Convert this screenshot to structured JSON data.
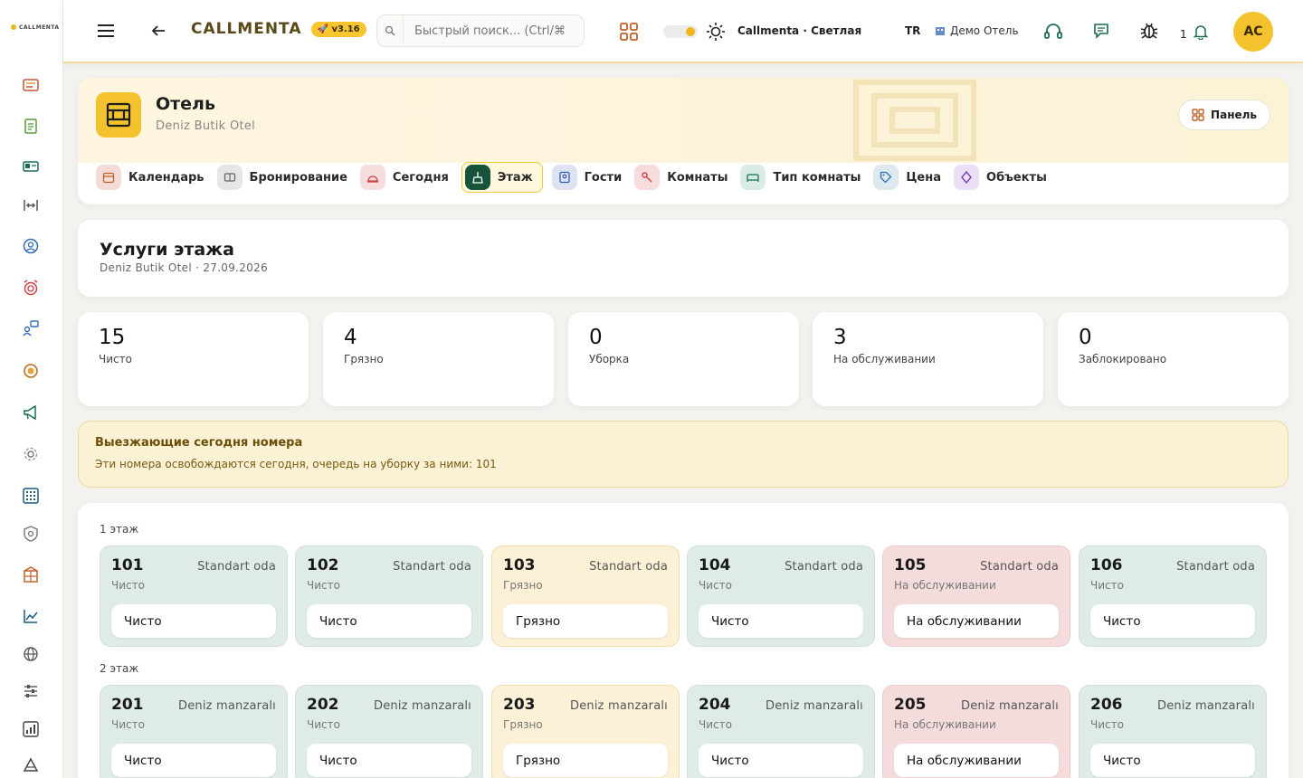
{
  "app": {
    "brand": "CALLMENTA",
    "version": "v3.16",
    "logo_text": "CALLMENTA"
  },
  "topbar": {
    "search_placeholder": "Быстрый поиск... (Ctrl/⌘",
    "theme_label": "Callmenta · Светлая",
    "language": "TR",
    "hotel_selector": "Демо Отель",
    "notifications_count": "1",
    "avatar_initials": "AC"
  },
  "sidebar": {
    "icons": [
      "reception-icon",
      "clipboard-icon",
      "id-card-icon",
      "transfer-icon",
      "support-agent-icon",
      "alarm-icon",
      "chat-user-icon",
      "medal-icon",
      "megaphone-icon",
      "settings-gear-icon",
      "grid-keypad-icon",
      "shield-icon",
      "building-icon",
      "chart-line-icon",
      "globe-icon",
      "sliders-icon",
      "report-chart-icon",
      "triangle-icon"
    ]
  },
  "header": {
    "title": "Отель",
    "subtitle": "Deniz Butik Otel",
    "panel_button": "Панель"
  },
  "tabs": [
    {
      "label": "Календарь",
      "icon": "calendar-icon",
      "color": "#f4dcd6",
      "active": false
    },
    {
      "label": "Бронирование",
      "icon": "booking-icon",
      "color": "#e6e6e6",
      "active": false
    },
    {
      "label": "Сегодня",
      "icon": "bell-service-icon",
      "color": "#f6dcdc",
      "active": false
    },
    {
      "label": "Этаж",
      "icon": "floor-broom-icon",
      "color": "#17523b",
      "active": true
    },
    {
      "label": "Гости",
      "icon": "guests-icon",
      "color": "#dde3f5",
      "active": false
    },
    {
      "label": "Комнаты",
      "icon": "key-icon",
      "color": "#f6dcdc",
      "active": false
    },
    {
      "label": "Тип комнаты",
      "icon": "bed-icon",
      "color": "#d8ece4",
      "active": false
    },
    {
      "label": "Цена",
      "icon": "tag-icon",
      "color": "#dde9ee",
      "active": false
    },
    {
      "label": "Объекты",
      "icon": "diamond-icon",
      "color": "#ebe0f5",
      "active": false
    }
  ],
  "page": {
    "title": "Услуги этажа",
    "subtitle": "Deniz Butik Otel · 27.09.2026"
  },
  "stats": [
    {
      "value": "15",
      "label": "Чисто"
    },
    {
      "value": "4",
      "label": "Грязно"
    },
    {
      "value": "0",
      "label": "Уборка"
    },
    {
      "value": "3",
      "label": "На обслуживании"
    },
    {
      "value": "0",
      "label": "Заблокировано"
    }
  ],
  "alert": {
    "title": "Выезжающие сегодня номера",
    "body": "Эти номера освобождаются сегодня, очередь на уборку за ними: 101"
  },
  "floors": [
    {
      "label": "1 этаж",
      "rooms": [
        {
          "number": "101",
          "type": "Standart oda",
          "status": "Чисто",
          "select": "Чисто",
          "state": "clean"
        },
        {
          "number": "102",
          "type": "Standart oda",
          "status": "Чисто",
          "select": "Чисто",
          "state": "clean"
        },
        {
          "number": "103",
          "type": "Standart oda",
          "status": "Грязно",
          "select": "Грязно",
          "state": "dirty"
        },
        {
          "number": "104",
          "type": "Standart oda",
          "status": "Чисто",
          "select": "Чисто",
          "state": "clean"
        },
        {
          "number": "105",
          "type": "Standart oda",
          "status": "На обслуживании",
          "select": "На обслуживании",
          "state": "maint"
        },
        {
          "number": "106",
          "type": "Standart oda",
          "status": "Чисто",
          "select": "Чисто",
          "state": "clean"
        }
      ]
    },
    {
      "label": "2 этаж",
      "rooms": [
        {
          "number": "201",
          "type": "Deniz manzaralı",
          "status": "Чисто",
          "select": "Чисто",
          "state": "clean"
        },
        {
          "number": "202",
          "type": "Deniz manzaralı",
          "status": "Чисто",
          "select": "Чисто",
          "state": "clean"
        },
        {
          "number": "203",
          "type": "Deniz manzaralı",
          "status": "Грязно",
          "select": "Грязно",
          "state": "dirty"
        },
        {
          "number": "204",
          "type": "Deniz manzaralı",
          "status": "Чисто",
          "select": "Чисто",
          "state": "clean"
        },
        {
          "number": "205",
          "type": "Deniz manzaralı",
          "status": "На обслуживании",
          "select": "На обслуживании",
          "state": "maint"
        },
        {
          "number": "206",
          "type": "Deniz manzaralı",
          "status": "Чисто",
          "select": "Чисто",
          "state": "clean"
        }
      ]
    }
  ],
  "colors": {
    "accent": "#f3c22c",
    "active_tab": "#17523b",
    "clean": "#dfece6",
    "dirty": "#fcf1d6",
    "maintenance": "#f5dcdc",
    "alert_bg": "#fbf1d4"
  }
}
